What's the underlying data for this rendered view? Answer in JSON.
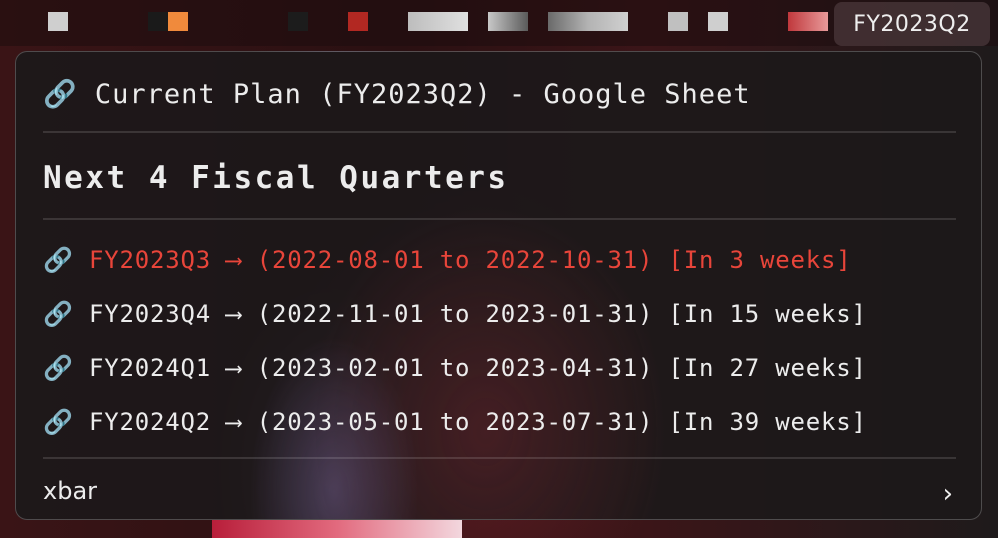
{
  "menubar": {
    "title": "FY2023Q2",
    "blocks": [
      {
        "color": "#cfcfcf"
      },
      {
        "color": "#1a1a1a"
      },
      {
        "color": "#f08a3c"
      },
      {
        "color": "#1c1c1c"
      },
      {
        "color": "#b22822"
      },
      {
        "color": "#d9d9d9"
      },
      {
        "color": "#c8c8c8"
      },
      {
        "color": "#b3b3b3"
      },
      {
        "color": "#d0d0d0"
      },
      {
        "color": "#c0c0c0"
      },
      {
        "color": "#cfcfcf"
      },
      {
        "color": "#c0383c"
      }
    ]
  },
  "menu": {
    "title_icon": "link-icon",
    "title": "🔗 Current Plan (FY2023Q2) - Google Sheet",
    "heading": "Next 4 Fiscal Quarters",
    "quarters": [
      {
        "icon": "🔗",
        "name": "FY2023Q3",
        "arrow": "⟶",
        "range": "(2022-08-01 to 2022-10-31)",
        "eta": "[In 3 weeks]",
        "color": "#e8453a"
      },
      {
        "icon": "🔗",
        "name": "FY2023Q4",
        "arrow": "⟶",
        "range": "(2022-11-01 to 2023-01-31)",
        "eta": "[In 15 weeks]",
        "color": "#ececec"
      },
      {
        "icon": "🔗",
        "name": "FY2024Q1",
        "arrow": "⟶",
        "range": "(2023-02-01 to 2023-04-31)",
        "eta": "[In 27 weeks]",
        "color": "#ececec"
      },
      {
        "icon": "🔗",
        "name": "FY2024Q2",
        "arrow": "⟶",
        "range": "(2023-05-01 to 2023-07-31)",
        "eta": "[In 39 weeks]",
        "color": "#ececec"
      }
    ],
    "footer": {
      "label": "xbar",
      "chevron": "›",
      "chevron_icon": "chevron-right-icon"
    }
  }
}
